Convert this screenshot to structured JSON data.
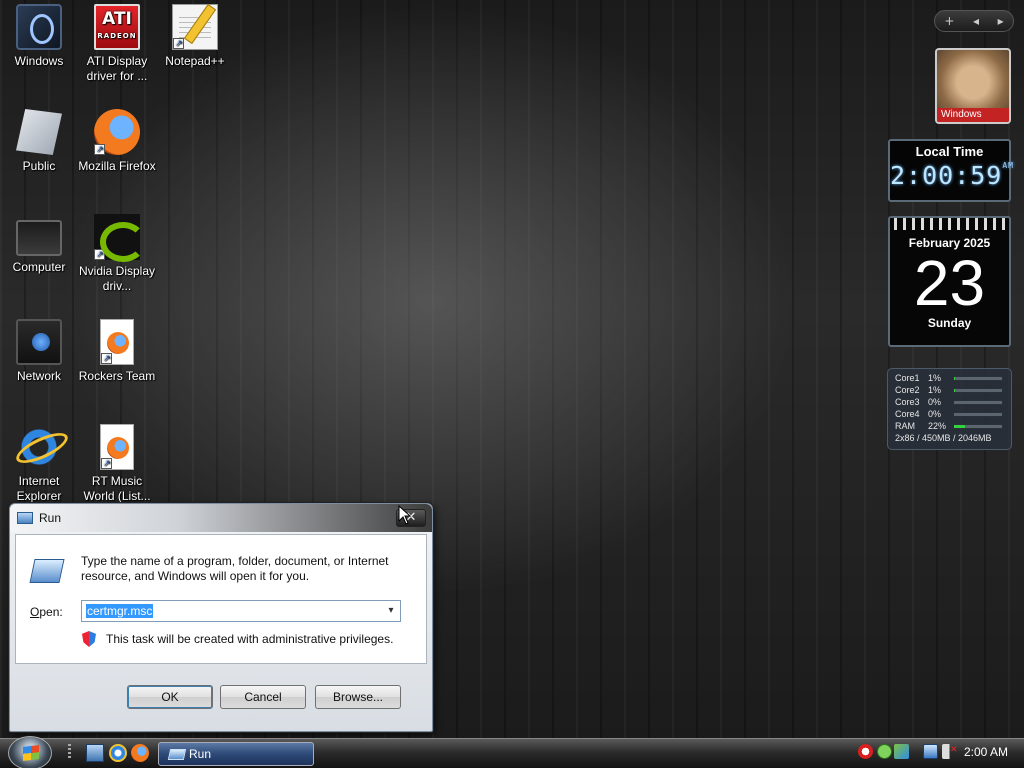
{
  "desktop": {
    "icons": [
      {
        "label": "Windows"
      },
      {
        "label": "ATI Display driver for ..."
      },
      {
        "label": "Notepad++"
      },
      {
        "label": "Public"
      },
      {
        "label": "Mozilla Firefox"
      },
      {
        "label": "Computer"
      },
      {
        "label": "Nvidia Display driv..."
      },
      {
        "label": "Network"
      },
      {
        "label": "Rockers Team"
      },
      {
        "label": "Internet Explorer"
      },
      {
        "label": "RT Music World (List..."
      }
    ],
    "ati_logo_text": "ATI",
    "ati_logo_sub": "RADEON"
  },
  "gadgets": {
    "sidebar_controls": {
      "add": "+",
      "prev": "◂",
      "next": "▸"
    },
    "picture": {
      "caption": "Windows"
    },
    "clock": {
      "title": "Local Time",
      "time": "2:00:59",
      "ampm": "AM"
    },
    "calendar": {
      "month": "February 2025",
      "day": "23",
      "weekday": "Sunday"
    },
    "cpu_meter": {
      "rows": [
        {
          "name": "Core1",
          "percent": "1%",
          "level": 0.01
        },
        {
          "name": "Core2",
          "percent": "1%",
          "level": 0.01
        },
        {
          "name": "Core3",
          "percent": "0%",
          "level": 0.0
        },
        {
          "name": "Core4",
          "percent": "0%",
          "level": 0.0
        },
        {
          "name": "RAM",
          "percent": "22%",
          "level": 0.22
        }
      ],
      "footer": "2x86 / 450MB / 2046MB",
      "bar_color": "#34d040"
    }
  },
  "run_dialog": {
    "title": "Run",
    "close_glyph": "✕",
    "description": "Type the name of a program, folder, document, or Internet resource, and Windows will open it for you.",
    "open_label_prefix": "",
    "open_label_accel": "O",
    "open_label_rest": "pen:",
    "input_value": "certmgr.msc",
    "dropdown_glyph": "▾",
    "admin_note": "This task will be created with administrative privileges.",
    "buttons": {
      "ok": "OK",
      "cancel": "Cancel",
      "browse": "Browse..."
    }
  },
  "taskbar": {
    "task_button_label": "Run",
    "clock": "2:00 AM"
  }
}
